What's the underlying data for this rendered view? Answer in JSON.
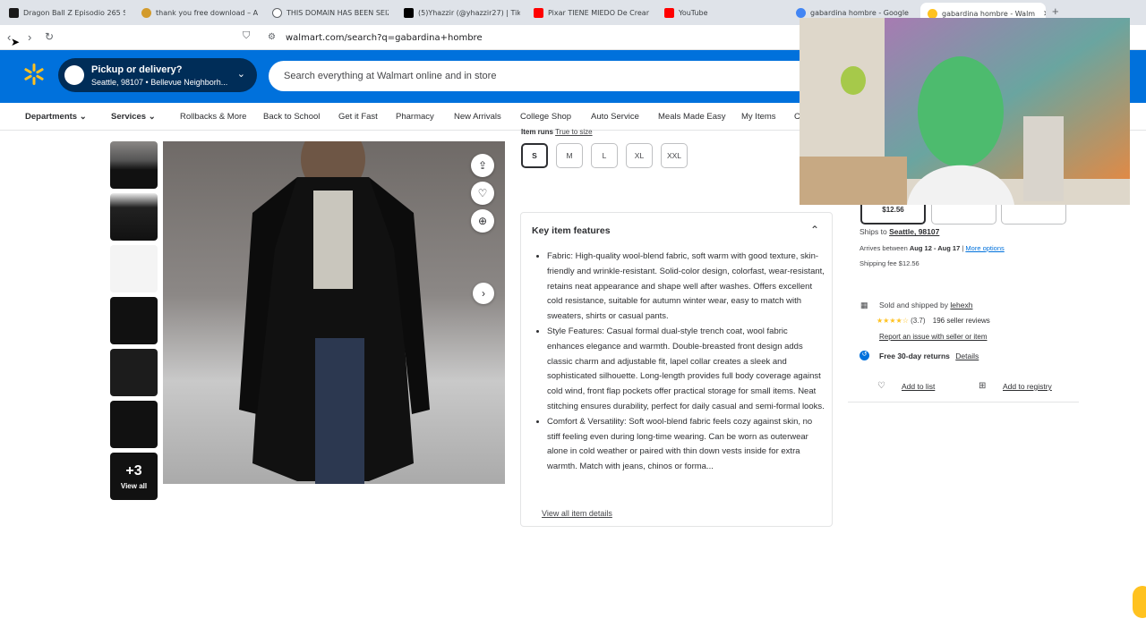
{
  "browser": {
    "tabs": [
      {
        "title": "Dragon Ball Z Episodio 265 Su",
        "color": "#1a1a1a"
      },
      {
        "title": "thank you free download – Af",
        "color": "#d39b2c"
      },
      {
        "title": "THIS DOMAIN HAS BEEN SEIZ",
        "color": "#5f6368"
      },
      {
        "title": "(5)Yhazzir (@yhazzir27) | TikTo",
        "color": "#000000"
      },
      {
        "title": "Pixar TIENE MIEDO De Crear V",
        "color": "#ff0000"
      },
      {
        "title": "YouTube",
        "color": "#ff0000"
      },
      {
        "title": "gabardina hombre - Google S",
        "color": "#4285f4"
      },
      {
        "title": "gabardina hombre - Walm",
        "color": "#ffc220"
      }
    ],
    "url": "walmart.com/search?q=gabardina+hombre"
  },
  "header": {
    "pickup_title": "Pickup or delivery?",
    "pickup_location": "Seattle, 98107 • Bellevue Neighborh...",
    "search_placeholder": "Search everything at Walmart online and in store"
  },
  "nav": {
    "items": [
      "Departments",
      "Services",
      "Rollbacks & More",
      "Back to School",
      "Get it Fast",
      "Pharmacy",
      "New Arrivals",
      "College Shop",
      "Auto Service",
      "Meals Made Easy",
      "My Items",
      "C"
    ]
  },
  "gallery": {
    "more_count": "+3",
    "view_all": "View all"
  },
  "sizes": {
    "fit_label": "Item runs",
    "fit_value": "True to size",
    "options": [
      "S",
      "M",
      "L",
      "XL",
      "XXL"
    ],
    "selected": "S"
  },
  "features": {
    "title": "Key item features",
    "bullets": [
      "Fabric: High-quality wool-blend fabric, soft warm with good texture, skin-friendly and wrinkle-resistant. Solid-color design, colorfast, wear-resistant, retains neat appearance and shape well after washes. Offers excellent cold resistance, suitable for autumn winter wear, easy to match with sweaters, shirts or casual pants.",
      "Style Features: Casual formal dual-style trench coat, wool fabric enhances elegance and warmth. Double-breasted front design adds classic charm and adjustable fit, lapel collar creates a sleek and sophisticated silhouette. Long-length provides full body coverage against cold wind, front flap pockets offer practical storage for small items. Neat stitching ensures durability, perfect for daily casual and semi-formal looks.",
      "Comfort & Versatility: Soft wool-blend fabric feels cozy against skin, no stiff feeling even during long-time wearing. Can be worn as outerwear alone in cold weather or paired with thin down vests inside for extra warmth. Match with jeans, chinos or forma..."
    ],
    "view_all": "View all item details"
  },
  "buybox": {
    "variant_price": "$12.56",
    "ships_to_label": "Ships to",
    "ships_to": "Seattle, 98107",
    "arrives_label": "Arrives between",
    "arrives_dates": "Aug 12 - Aug 17",
    "more_options": "More options",
    "shipping_fee": "Shipping fee $12.56",
    "sold_by_label": "Sold and shipped by",
    "seller": "lehexh",
    "seller_rating": "(3.7)",
    "seller_rating_value": 3.7,
    "seller_reviews": "196 seller reviews",
    "report": "Report an issue with seller or item",
    "returns": "Free 30-day returns",
    "returns_details": "Details",
    "add_to_list": "Add to list",
    "add_to_registry": "Add to registry"
  },
  "colors": {
    "walmart_blue": "#0071dc",
    "walmart_dark": "#002d58",
    "spark_yellow": "#ffc220"
  }
}
